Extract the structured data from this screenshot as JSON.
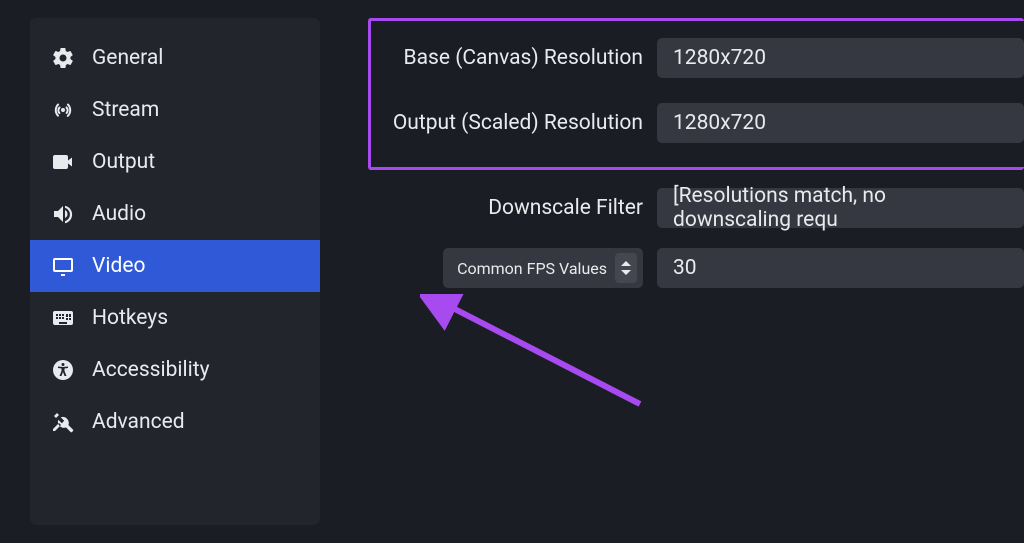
{
  "sidebar": {
    "items": [
      {
        "label": "General",
        "icon": "gear"
      },
      {
        "label": "Stream",
        "icon": "antenna"
      },
      {
        "label": "Output",
        "icon": "camera"
      },
      {
        "label": "Audio",
        "icon": "speaker"
      },
      {
        "label": "Video",
        "icon": "monitor"
      },
      {
        "label": "Hotkeys",
        "icon": "keyboard"
      },
      {
        "label": "Accessibility",
        "icon": "accessibility"
      },
      {
        "label": "Advanced",
        "icon": "tools"
      }
    ],
    "selected_index": 4
  },
  "settings": {
    "base_resolution": {
      "label": "Base (Canvas) Resolution",
      "value": "1280x720"
    },
    "output_resolution": {
      "label": "Output (Scaled) Resolution",
      "value": "1280x720"
    },
    "downscale_filter": {
      "label": "Downscale Filter",
      "value": "[Resolutions match, no downscaling requ"
    },
    "fps": {
      "label": "Common FPS Values",
      "value": "30"
    }
  },
  "annotation": {
    "highlight_color": "#a74af0"
  }
}
